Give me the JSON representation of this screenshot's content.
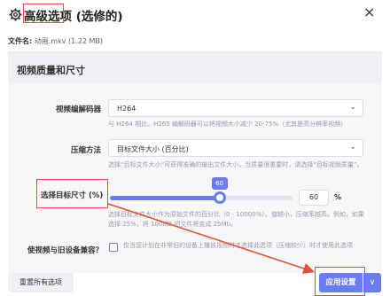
{
  "header": {
    "title": "高级选项 (选修的)",
    "close_label": "×"
  },
  "file": {
    "label": "文件名:",
    "value": "动画.mkv (1.22 MB)"
  },
  "panel": {
    "title": "视频质量和尺寸"
  },
  "encoder": {
    "label": "视频编解码器",
    "value": "H264",
    "hint": "与 H264 相比，H265 编解码器可以将视频大小减少 20-75%（尤其是高分辨率视频）"
  },
  "compression": {
    "label": "压缩方法",
    "value": "目标文件大小 (百分比)",
    "hint": "选择“目标文件大小”可获得准确的输出文件大小，当质量很重要时，请选择“目标视频质量”。"
  },
  "target_size": {
    "label": "选择目标尺寸 (%)",
    "value": "60",
    "tooltip": "60",
    "unit": "%",
    "fraction": 0.6,
    "hint": "选择目标文件大小作为原始文件的百分比（0 - 10000%）。值越小，压缩率越高。例如，如果选择 25%，将 100MB 的文件将变成 25Mb。"
  },
  "compat": {
    "label": "使视频与旧设备兼容？",
    "hint": "仅当您计划在非常旧的设备上播放视频时才选择此选项（压缩较少）时才使用此选项"
  },
  "footer": {
    "reset_label": "重置所有选项",
    "apply_label": "应用设置",
    "dropdown_label": "∨"
  },
  "colors": {
    "accent": "#6a7cf0",
    "highlight": "#e0533a"
  }
}
